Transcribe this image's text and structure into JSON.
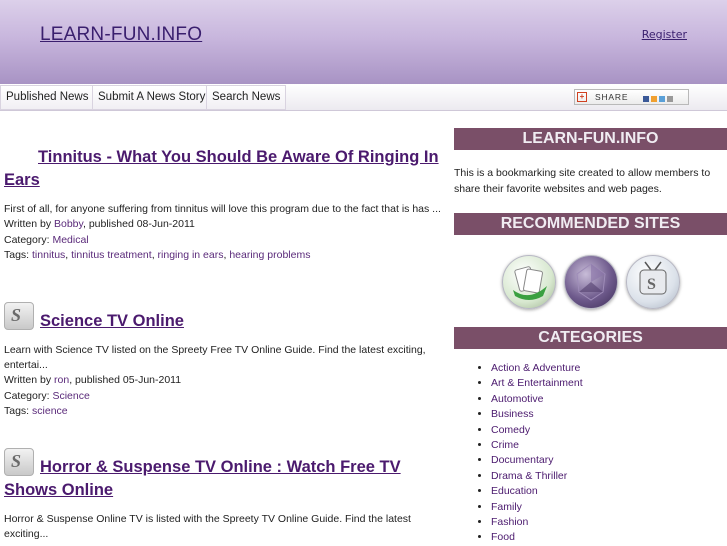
{
  "header": {
    "site_title": "LEARN-FUN.INFO",
    "register_label": "Register"
  },
  "nav": {
    "items": [
      "Published News",
      "Submit A News Story",
      "Search News"
    ],
    "share_label": "SHARE"
  },
  "posts": [
    {
      "title": "Tinnitus - What You Should Be Aware Of Ringing In Ears",
      "has_icon": false,
      "excerpt": "First of all, for anyone suffering from tinnitus will love this program due to the fact that is has ...",
      "written_by_prefix": "Written by ",
      "author": "Bobby",
      "published": ", published 08-Jun-2011",
      "category_prefix": "Category: ",
      "category": "Medical",
      "tags_prefix": "Tags: ",
      "tags": [
        "tinnitus",
        "tinnitus treatment",
        "ringing in ears",
        "hearing problems"
      ]
    },
    {
      "title": "Science TV Online",
      "has_icon": true,
      "excerpt": "Learn with Science TV listed on the Spreety Free TV Online Guide. Find the latest exciting, entertai...",
      "written_by_prefix": "Written by ",
      "author": "ron",
      "published": ", published 05-Jun-2011",
      "category_prefix": "Category: ",
      "category": "Science",
      "tags_prefix": "Tags: ",
      "tags": [
        "science"
      ]
    },
    {
      "title": "Horror & Suspense TV Online : Watch Free TV Shows Online",
      "has_icon": true,
      "excerpt": "Horror & Suspense Online TV is listed with the Spreety TV Online Guide. Find the latest exciting..."
    }
  ],
  "sidebar": {
    "about_heading": "LEARN-FUN.INFO",
    "about_text": "This is a bookmarking site created to allow members to share their favorite websites and web pages.",
    "recommended_heading": "RECOMMENDED SITES",
    "recommended_icons": [
      "cards-game-icon",
      "purple-sphere-icon",
      "tv-s-icon"
    ],
    "categories_heading": "CATEGORIES",
    "categories": [
      "Action & Adventure",
      "Art & Entertainment",
      "Automotive",
      "Business",
      "Comedy",
      "Crime",
      "Documentary",
      "Drama & Thriller",
      "Education",
      "Family",
      "Fashion",
      "Food"
    ]
  },
  "colors": {
    "header_gradient_top": "#dcd0ea",
    "header_gradient_bottom": "#a893c4",
    "sidebar_heading_bg": "#7a4f68",
    "link": "#4b1a6e"
  }
}
